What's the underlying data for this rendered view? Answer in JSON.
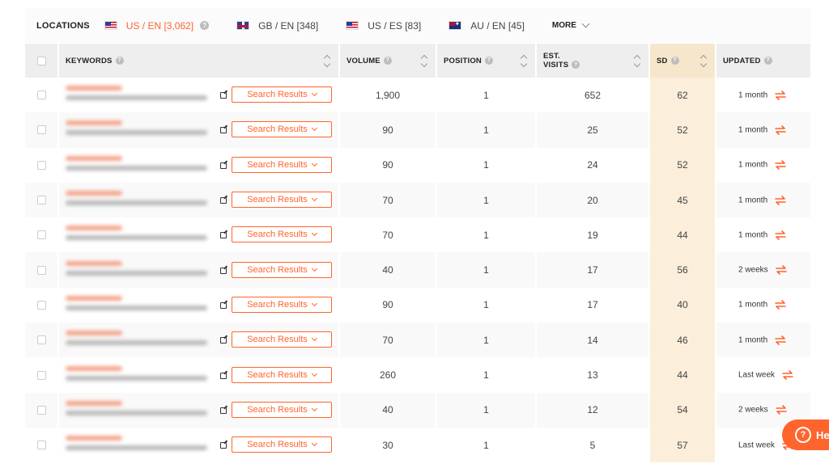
{
  "locations": {
    "label": "LOCATIONS",
    "items": [
      {
        "flag": "us",
        "text": "US / EN [3,062]",
        "active": true
      },
      {
        "flag": "gb",
        "text": "GB / EN [348]",
        "active": false
      },
      {
        "flag": "us",
        "text": "US / ES [83]",
        "active": false
      },
      {
        "flag": "au",
        "text": "AU / EN [45]",
        "active": false
      }
    ],
    "more_label": "MORE"
  },
  "table": {
    "headers": {
      "keywords": "KEYWORDS",
      "volume": "VOLUME",
      "position": "POSITION",
      "est_visits_1": "EST.",
      "est_visits_2": "VISITS",
      "sd": "SD",
      "updated": "UPDATED"
    },
    "search_results_label": "Search Results",
    "rows": [
      {
        "volume": "1,900",
        "position": "1",
        "visits": "652",
        "sd": "62",
        "updated": "1 month"
      },
      {
        "volume": "90",
        "position": "1",
        "visits": "25",
        "sd": "52",
        "updated": "1 month"
      },
      {
        "volume": "90",
        "position": "1",
        "visits": "24",
        "sd": "52",
        "updated": "1 month"
      },
      {
        "volume": "70",
        "position": "1",
        "visits": "20",
        "sd": "45",
        "updated": "1 month"
      },
      {
        "volume": "70",
        "position": "1",
        "visits": "19",
        "sd": "44",
        "updated": "1 month"
      },
      {
        "volume": "40",
        "position": "1",
        "visits": "17",
        "sd": "56",
        "updated": "2 weeks"
      },
      {
        "volume": "90",
        "position": "1",
        "visits": "17",
        "sd": "40",
        "updated": "1 month"
      },
      {
        "volume": "70",
        "position": "1",
        "visits": "14",
        "sd": "46",
        "updated": "1 month"
      },
      {
        "volume": "260",
        "position": "1",
        "visits": "13",
        "sd": "44",
        "updated": "Last week"
      },
      {
        "volume": "40",
        "position": "1",
        "visits": "12",
        "sd": "54",
        "updated": "2 weeks"
      },
      {
        "volume": "30",
        "position": "1",
        "visits": "5",
        "sd": "57",
        "updated": "Last week"
      }
    ]
  },
  "help_widget": {
    "label": "He"
  },
  "colors": {
    "accent": "#ff642d",
    "sd_column": "#fbefdc"
  }
}
